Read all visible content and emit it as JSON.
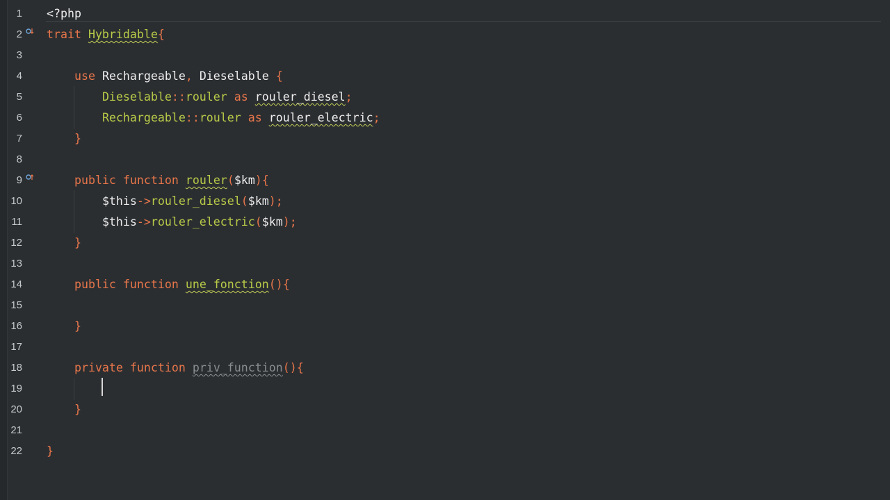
{
  "editor": {
    "language": "php",
    "caret_line": 19,
    "lines": [
      {
        "number": "1",
        "tokens": [
          {
            "t": "<?php",
            "c": "plain"
          }
        ]
      },
      {
        "number": "2",
        "tokens": [
          {
            "t": "trait",
            "c": "kw"
          },
          {
            "t": " ",
            "c": "plain"
          },
          {
            "t": "Hybridable",
            "c": "cls squig"
          },
          {
            "t": "{",
            "c": "punc"
          }
        ],
        "marker": "override-down-icon"
      },
      {
        "number": "3",
        "tokens": []
      },
      {
        "number": "4",
        "tokens": [
          {
            "t": "    ",
            "c": "plain"
          },
          {
            "t": "use",
            "c": "kw"
          },
          {
            "t": " Rechargeable",
            "c": "plain"
          },
          {
            "t": ",",
            "c": "punc"
          },
          {
            "t": " Dieselable ",
            "c": "plain"
          },
          {
            "t": "{",
            "c": "punc"
          }
        ]
      },
      {
        "number": "5",
        "tokens": [
          {
            "t": "        ",
            "c": "plain"
          },
          {
            "t": "Dieselable",
            "c": "cls"
          },
          {
            "t": "::",
            "c": "punc"
          },
          {
            "t": "rouler",
            "c": "fn"
          },
          {
            "t": " ",
            "c": "plain"
          },
          {
            "t": "as",
            "c": "kw"
          },
          {
            "t": " ",
            "c": "plain"
          },
          {
            "t": "rouler_diesel",
            "c": "plain squig-w"
          },
          {
            "t": ";",
            "c": "punc"
          }
        ]
      },
      {
        "number": "6",
        "tokens": [
          {
            "t": "        ",
            "c": "plain"
          },
          {
            "t": "Rechargeable",
            "c": "cls"
          },
          {
            "t": "::",
            "c": "punc"
          },
          {
            "t": "rouler",
            "c": "fn"
          },
          {
            "t": " ",
            "c": "plain"
          },
          {
            "t": "as",
            "c": "kw"
          },
          {
            "t": " ",
            "c": "plain"
          },
          {
            "t": "rouler_electric",
            "c": "plain squig-w"
          },
          {
            "t": ";",
            "c": "punc"
          }
        ]
      },
      {
        "number": "7",
        "tokens": [
          {
            "t": "    ",
            "c": "plain"
          },
          {
            "t": "}",
            "c": "punc"
          }
        ]
      },
      {
        "number": "8",
        "tokens": []
      },
      {
        "number": "9",
        "tokens": [
          {
            "t": "    ",
            "c": "plain"
          },
          {
            "t": "public",
            "c": "kw"
          },
          {
            "t": " ",
            "c": "plain"
          },
          {
            "t": "function",
            "c": "kw"
          },
          {
            "t": " ",
            "c": "plain"
          },
          {
            "t": "rouler",
            "c": "fn squig"
          },
          {
            "t": "(",
            "c": "punc"
          },
          {
            "t": "$km",
            "c": "plain"
          },
          {
            "t": "){",
            "c": "punc"
          }
        ],
        "marker": "override-up-icon"
      },
      {
        "number": "10",
        "tokens": [
          {
            "t": "        ",
            "c": "plain"
          },
          {
            "t": "$this",
            "c": "plain"
          },
          {
            "t": "->",
            "c": "punc"
          },
          {
            "t": "rouler_diesel",
            "c": "fn"
          },
          {
            "t": "(",
            "c": "punc"
          },
          {
            "t": "$km",
            "c": "plain"
          },
          {
            "t": ");",
            "c": "punc"
          }
        ]
      },
      {
        "number": "11",
        "tokens": [
          {
            "t": "        ",
            "c": "plain"
          },
          {
            "t": "$this",
            "c": "plain"
          },
          {
            "t": "->",
            "c": "punc"
          },
          {
            "t": "rouler_electric",
            "c": "fn"
          },
          {
            "t": "(",
            "c": "punc"
          },
          {
            "t": "$km",
            "c": "plain"
          },
          {
            "t": ");",
            "c": "punc"
          }
        ]
      },
      {
        "number": "12",
        "tokens": [
          {
            "t": "    ",
            "c": "plain"
          },
          {
            "t": "}",
            "c": "punc"
          }
        ]
      },
      {
        "number": "13",
        "tokens": []
      },
      {
        "number": "14",
        "tokens": [
          {
            "t": "    ",
            "c": "plain"
          },
          {
            "t": "public",
            "c": "kw"
          },
          {
            "t": " ",
            "c": "plain"
          },
          {
            "t": "function",
            "c": "kw"
          },
          {
            "t": " ",
            "c": "plain"
          },
          {
            "t": "une_fonction",
            "c": "fn squig"
          },
          {
            "t": "(){",
            "c": "punc"
          }
        ]
      },
      {
        "number": "15",
        "tokens": []
      },
      {
        "number": "16",
        "tokens": [
          {
            "t": "    ",
            "c": "plain"
          },
          {
            "t": "}",
            "c": "punc"
          }
        ]
      },
      {
        "number": "17",
        "tokens": []
      },
      {
        "number": "18",
        "tokens": [
          {
            "t": "    ",
            "c": "plain"
          },
          {
            "t": "private",
            "c": "kw"
          },
          {
            "t": " ",
            "c": "plain"
          },
          {
            "t": "function",
            "c": "kw"
          },
          {
            "t": " ",
            "c": "plain"
          },
          {
            "t": "priv_function",
            "c": "muted squig-grey"
          },
          {
            "t": "(){",
            "c": "punc"
          }
        ]
      },
      {
        "number": "19",
        "tokens": []
      },
      {
        "number": "20",
        "tokens": [
          {
            "t": "    ",
            "c": "plain"
          },
          {
            "t": "}",
            "c": "punc"
          }
        ]
      },
      {
        "number": "21",
        "tokens": []
      },
      {
        "number": "22",
        "tokens": [
          {
            "t": "}",
            "c": "punc"
          }
        ]
      }
    ]
  },
  "colors": {
    "background": "#2b2e31",
    "keyword": "#e8764a",
    "function": "#b9cb48",
    "text": "#ededed",
    "line_number": "#c6c9cc"
  }
}
